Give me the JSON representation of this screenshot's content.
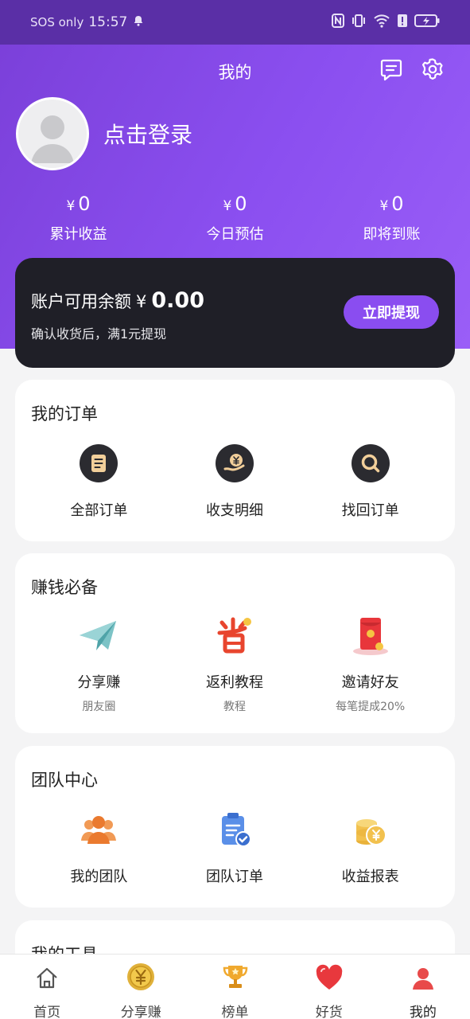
{
  "status_bar": {
    "carrier": "SOS only",
    "time": "15:57"
  },
  "header": {
    "title": "我的",
    "login_text": "点击登录"
  },
  "stats": [
    {
      "currency": "¥",
      "value": "0",
      "label": "累计收益"
    },
    {
      "currency": "¥",
      "value": "0",
      "label": "今日预估"
    },
    {
      "currency": "¥",
      "value": "0",
      "label": "即将到账"
    }
  ],
  "balance": {
    "label": "账户可用余额",
    "currency": "¥",
    "amount": "0.00",
    "note": "确认收货后，满1元提现",
    "withdraw_button": "立即提现"
  },
  "orders": {
    "title": "我的订单",
    "items": [
      {
        "label": "全部订单",
        "icon": "document-icon"
      },
      {
        "label": "收支明细",
        "icon": "yen-hand-icon"
      },
      {
        "label": "找回订单",
        "icon": "search-icon"
      }
    ]
  },
  "earn": {
    "title": "赚钱必备",
    "items": [
      {
        "label": "分享赚",
        "sub": "朋友圈",
        "icon": "paper-plane-icon"
      },
      {
        "label": "返利教程",
        "sub": "教程",
        "icon": "save-sheng-icon"
      },
      {
        "label": "邀请好友",
        "sub": "每笔提成20%",
        "icon": "red-envelope-icon"
      }
    ]
  },
  "team": {
    "title": "团队中心",
    "items": [
      {
        "label": "我的团队",
        "icon": "team-icon"
      },
      {
        "label": "团队订单",
        "icon": "clipboard-check-icon"
      },
      {
        "label": "收益报表",
        "icon": "coins-icon"
      }
    ]
  },
  "tools": {
    "title": "我的工具"
  },
  "tabbar": [
    {
      "label": "首页",
      "icon": "home-icon"
    },
    {
      "label": "分享赚",
      "icon": "yen-coin-icon"
    },
    {
      "label": "榜单",
      "icon": "trophy-icon"
    },
    {
      "label": "好货",
      "icon": "heart-icon"
    },
    {
      "label": "我的",
      "icon": "user-icon"
    }
  ],
  "colors": {
    "brand": "#8a4df0",
    "card_dark": "#1f1f27",
    "background": "#f4f4f5"
  }
}
